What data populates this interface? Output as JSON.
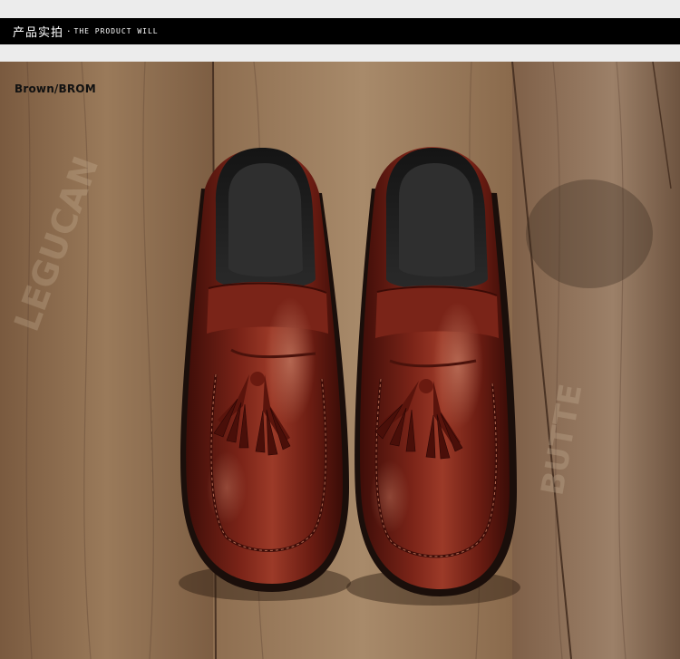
{
  "header": {
    "title_zh": "产品实拍",
    "separator": "·",
    "title_en": "THE PRODUCT WILL"
  },
  "product": {
    "color_label": "Brown/BROM"
  },
  "colors": {
    "header_bg": "#000000",
    "leather": "#6e1f16",
    "wood": "#8a6a4c"
  }
}
